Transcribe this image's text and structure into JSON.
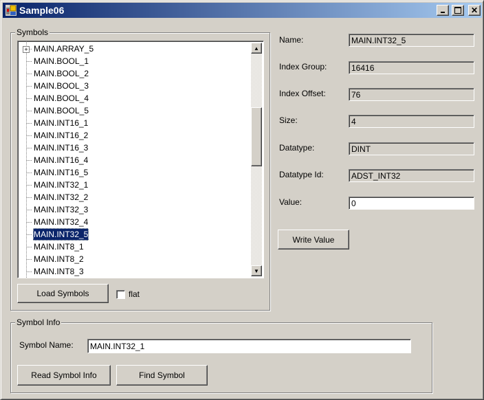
{
  "window": {
    "title": "Sample06",
    "controls": {
      "minimize": "_",
      "maximize": "□",
      "close": "✕"
    }
  },
  "symbols_group": {
    "label": "Symbols",
    "tree_items": [
      {
        "label": "MAIN.ARRAY_5",
        "expandable": true,
        "selected": false
      },
      {
        "label": "MAIN.BOOL_1",
        "expandable": false,
        "selected": false
      },
      {
        "label": "MAIN.BOOL_2",
        "expandable": false,
        "selected": false
      },
      {
        "label": "MAIN.BOOL_3",
        "expandable": false,
        "selected": false
      },
      {
        "label": "MAIN.BOOL_4",
        "expandable": false,
        "selected": false
      },
      {
        "label": "MAIN.BOOL_5",
        "expandable": false,
        "selected": false
      },
      {
        "label": "MAIN.INT16_1",
        "expandable": false,
        "selected": false
      },
      {
        "label": "MAIN.INT16_2",
        "expandable": false,
        "selected": false
      },
      {
        "label": "MAIN.INT16_3",
        "expandable": false,
        "selected": false
      },
      {
        "label": "MAIN.INT16_4",
        "expandable": false,
        "selected": false
      },
      {
        "label": "MAIN.INT16_5",
        "expandable": false,
        "selected": false
      },
      {
        "label": "MAIN.INT32_1",
        "expandable": false,
        "selected": false
      },
      {
        "label": "MAIN.INT32_2",
        "expandable": false,
        "selected": false
      },
      {
        "label": "MAIN.INT32_3",
        "expandable": false,
        "selected": false
      },
      {
        "label": "MAIN.INT32_4",
        "expandable": false,
        "selected": false
      },
      {
        "label": "MAIN.INT32_5",
        "expandable": false,
        "selected": true
      },
      {
        "label": "MAIN.INT8_1",
        "expandable": false,
        "selected": false
      },
      {
        "label": "MAIN.INT8_2",
        "expandable": false,
        "selected": false
      },
      {
        "label": "MAIN.INT8_3",
        "expandable": false,
        "selected": false
      }
    ],
    "expander_glyph": "+",
    "scroll_up_glyph": "▲",
    "scroll_down_glyph": "▼",
    "load_button": "Load Symbols",
    "flat_checkbox": {
      "label": "flat",
      "checked": false
    }
  },
  "details": {
    "name": {
      "label": "Name:",
      "value": "MAIN.INT32_5"
    },
    "index_group": {
      "label": "Index Group:",
      "value": "16416"
    },
    "index_offset": {
      "label": "Index Offset:",
      "value": "76"
    },
    "size": {
      "label": "Size:",
      "value": "4"
    },
    "datatype": {
      "label": "Datatype:",
      "value": "DINT"
    },
    "datatype_id": {
      "label": "Datatype Id:",
      "value": "ADST_INT32"
    },
    "value": {
      "label": "Value:",
      "value": "0"
    },
    "write_button": "Write Value"
  },
  "symbol_info_group": {
    "label": "Symbol Info",
    "symbol_name_label": "Symbol Name:",
    "symbol_name_value": "MAIN.INT32_1",
    "read_button": "Read Symbol Info",
    "find_button": "Find Symbol"
  }
}
